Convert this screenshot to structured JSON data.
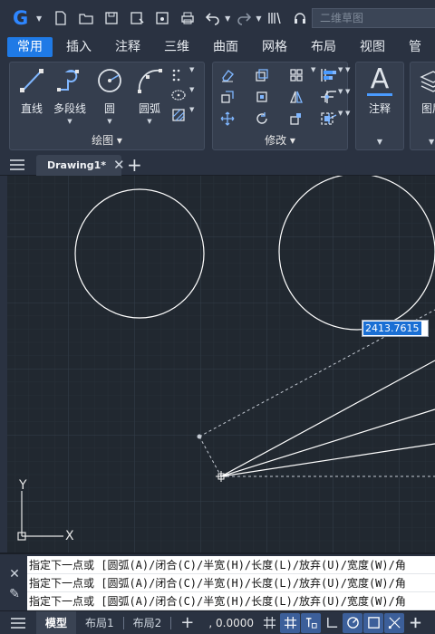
{
  "quick_access": {
    "logo": "G",
    "workspace_placeholder": "二维草图",
    "icons": [
      "new-file-icon",
      "open-folder-icon",
      "save-icon",
      "save-as-icon",
      "batch-save-icon",
      "print-icon",
      "undo-icon",
      "redo-icon",
      "match-properties-icon",
      "headset-icon"
    ]
  },
  "ribbon_tabs": [
    "常用",
    "插入",
    "注释",
    "三维",
    "曲面",
    "网格",
    "布局",
    "视图",
    "管"
  ],
  "active_tab": "常用",
  "ribbon": {
    "draw_panel": {
      "title": "绘图 ▾",
      "tools": [
        {
          "label": "直线",
          "icon": "line-icon"
        },
        {
          "label": "多段线",
          "icon": "polyline-icon"
        },
        {
          "label": "圆",
          "icon": "circle-icon"
        },
        {
          "label": "圆弧",
          "icon": "arc-icon"
        }
      ]
    },
    "modify_panel": {
      "title": "修改 ▾"
    },
    "annotation_panel": {
      "label": "注释",
      "glyph": "A"
    },
    "layer_panel": {
      "label": "图层"
    }
  },
  "file_tab": {
    "name": "Drawing1*",
    "close": "✕",
    "new": "+"
  },
  "canvas": {
    "dimension_input": "2413.7615",
    "ucs": {
      "x_label": "X",
      "y_label": "Y"
    }
  },
  "command_lines": [
    "指定下一点或 [圆弧(A)/闭合(C)/半宽(H)/长度(L)/放弃(U)/宽度(W)/角",
    "指定下一点或 [圆弧(A)/闭合(C)/半宽(H)/长度(L)/放弃(U)/宽度(W)/角",
    "指定下一点或 [圆弧(A)/闭合(C)/半宽(H)/长度(L)/放弃(U)/宽度(W)/角"
  ],
  "status_bar": {
    "tabs": [
      "模型",
      "布局1",
      "布局2"
    ],
    "active": "模型",
    "coord": ", 0.0000",
    "toggles": [
      "grid-display-icon",
      "snap-grid-icon",
      "infer-constraints-icon",
      "ortho-icon",
      "polar-icon",
      "osnap-icon",
      "otrack-icon",
      "lineweight-icon"
    ]
  },
  "colors": {
    "accent": "#1f7ae6",
    "canvas": "#212830",
    "ui": "#2a3241"
  }
}
